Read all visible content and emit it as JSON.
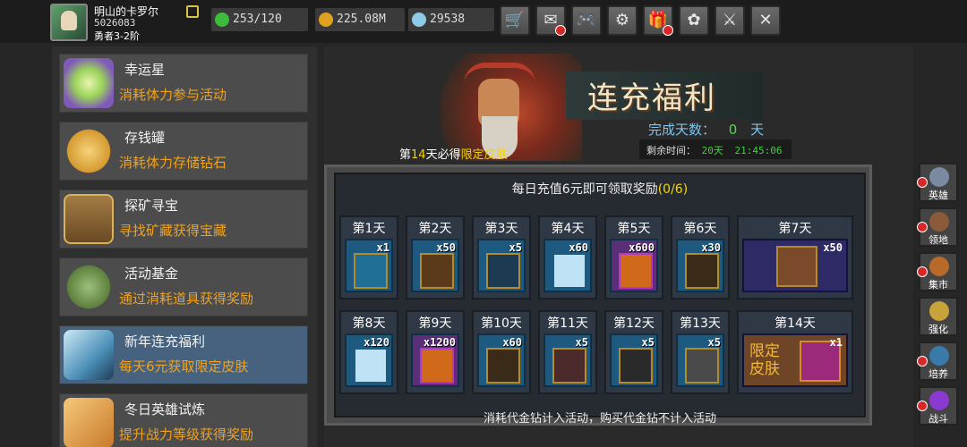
{
  "player": {
    "name": "明山的卡罗尔",
    "id": "5026083",
    "rank": "勇者3-2阶"
  },
  "resources": {
    "stamina": "253/120",
    "gold": "225.08M",
    "gems": "29538"
  },
  "toolbar": {
    "buttons": [
      "shop-icon",
      "mail-icon",
      "gamepad-icon",
      "gear-icon",
      "gift-icon",
      "pinwheel-icon",
      "sword-icon",
      "swords-icon"
    ]
  },
  "sidebar": {
    "items": [
      {
        "title": "幸运星",
        "desc": "消耗体力参与活动"
      },
      {
        "title": "存钱罐",
        "desc": "消耗体力存储钻石"
      },
      {
        "title": "探矿寻宝",
        "desc": "寻找矿藏获得宝藏"
      },
      {
        "title": "活动基金",
        "desc": "通过消耗道具获得奖励"
      },
      {
        "title": "新年连充福利",
        "desc": "每天6元获取限定皮肤"
      },
      {
        "title": "冬日英雄试炼",
        "desc": "提升战力等级获得奖励"
      }
    ]
  },
  "banner": {
    "title": "连充福利",
    "done_label": "完成天数：",
    "done_value": "0",
    "done_unit": "天",
    "remain_label": "剩余时间：",
    "remain_days": "20天",
    "remain_time": "21:45:06",
    "skin_note_a": "第",
    "skin_note_b": "14",
    "skin_note_c": "天必得",
    "skin_note_d": "限定皮肤"
  },
  "rewards": {
    "header": "每日充值6元即可领取奖励",
    "progress": "(0/6)",
    "footer": "消耗代金钻计入活动，购买代金钻不计入活动",
    "days": [
      {
        "label": "第1天",
        "count": "x1"
      },
      {
        "label": "第2天",
        "count": "x50"
      },
      {
        "label": "第3天",
        "count": "x5"
      },
      {
        "label": "第4天",
        "count": "x60"
      },
      {
        "label": "第5天",
        "count": "x600"
      },
      {
        "label": "第6天",
        "count": "x30"
      },
      {
        "label": "第7天",
        "count": "x50"
      },
      {
        "label": "第8天",
        "count": "x120"
      },
      {
        "label": "第9天",
        "count": "x1200"
      },
      {
        "label": "第10天",
        "count": "x60"
      },
      {
        "label": "第11天",
        "count": "x5"
      },
      {
        "label": "第12天",
        "count": "x5"
      },
      {
        "label": "第13天",
        "count": "x5"
      },
      {
        "label": "第14天",
        "count": "x1",
        "skin_a": "限定",
        "skin_b": "皮肤"
      }
    ]
  },
  "rightnav": {
    "items": [
      "英雄",
      "领地",
      "集市",
      "强化",
      "培养",
      "战斗"
    ]
  }
}
